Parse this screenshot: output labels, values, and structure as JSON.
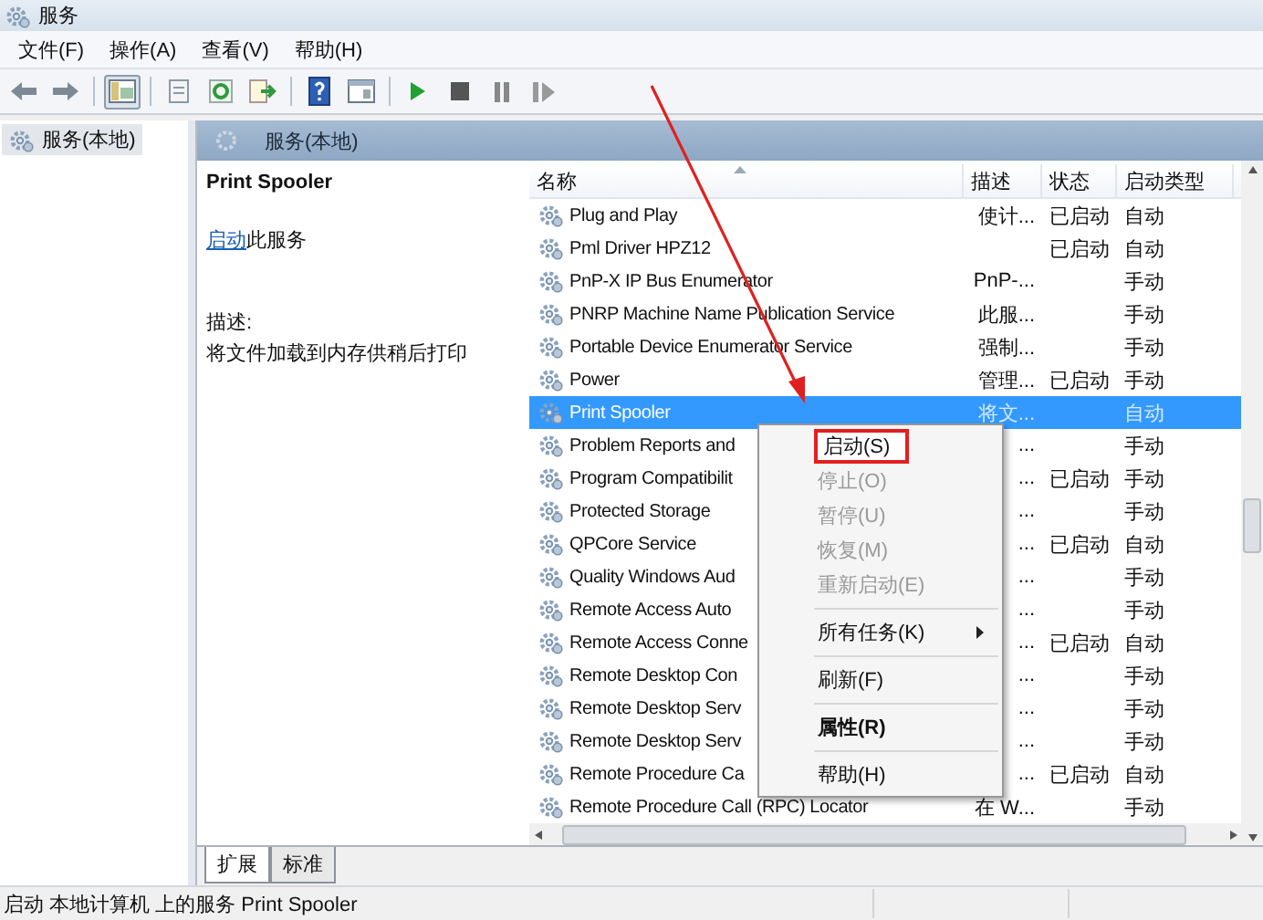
{
  "window": {
    "title": "服务"
  },
  "menu": [
    "文件(F)",
    "操作(A)",
    "查看(V)",
    "帮助(H)"
  ],
  "toolbar": [
    {
      "kind": "back"
    },
    {
      "kind": "forward"
    },
    {
      "kind": "sep"
    },
    {
      "kind": "tree",
      "selected": true
    },
    {
      "kind": "sep"
    },
    {
      "kind": "props"
    },
    {
      "kind": "refresh"
    },
    {
      "kind": "export"
    },
    {
      "kind": "sep"
    },
    {
      "kind": "help"
    },
    {
      "kind": "view"
    },
    {
      "kind": "sep"
    },
    {
      "kind": "play"
    },
    {
      "kind": "stop"
    },
    {
      "kind": "pause"
    },
    {
      "kind": "resume"
    }
  ],
  "tree": [
    {
      "label": "服务(本地)",
      "selected": true
    }
  ],
  "panel_title": "服务(本地)",
  "detail": {
    "service": "Print Spooler",
    "action_link": "启动",
    "action_text": "此服务",
    "description_label": "描述:",
    "description": "将文件加载到内存供稍后打印"
  },
  "table": {
    "columns": [
      "名称",
      "描述",
      "状态",
      "启动类型"
    ],
    "rows": [
      {
        "name": "Plug and Play",
        "desc": "使计...",
        "status": "已启动",
        "startup": "自动",
        "selected": false
      },
      {
        "name": "Pml Driver HPZ12",
        "status": "已启动",
        "startup": "自动",
        "selected": false
      },
      {
        "name": "PnP-X IP Bus Enumerator",
        "desc": "PnP-...",
        "startup": "手动",
        "selected": false
      },
      {
        "name": "PNRP Machine Name Publication Service",
        "desc": "此服...",
        "startup": "手动",
        "selected": false
      },
      {
        "name": "Portable Device Enumerator Service",
        "desc": "强制...",
        "startup": "手动",
        "selected": false
      },
      {
        "name": "Power",
        "desc": "管理...",
        "status": "已启动",
        "startup": "手动",
        "selected": false
      },
      {
        "name": "Print Spooler",
        "desc": "将文...",
        "startup": "自动",
        "selected": true
      },
      {
        "name": "Problem Reports and",
        "desc": "...",
        "startup": "手动",
        "selected": false
      },
      {
        "name": "Program Compatibilit",
        "desc": "...",
        "status": "已启动",
        "startup": "手动",
        "selected": false
      },
      {
        "name": "Protected Storage",
        "desc": "...",
        "startup": "手动",
        "selected": false
      },
      {
        "name": "QPCore Service",
        "desc": "...",
        "status": "已启动",
        "startup": "自动",
        "selected": false
      },
      {
        "name": "Quality Windows Aud",
        "desc": "...",
        "startup": "手动",
        "selected": false
      },
      {
        "name": "Remote Access Auto",
        "desc": "...",
        "startup": "手动",
        "selected": false
      },
      {
        "name": "Remote Access Conne",
        "desc": "...",
        "status": "已启动",
        "startup": "自动",
        "selected": false
      },
      {
        "name": "Remote Desktop Con",
        "desc": "...",
        "startup": "手动",
        "selected": false
      },
      {
        "name": "Remote Desktop Serv",
        "desc": "...",
        "startup": "手动",
        "selected": false
      },
      {
        "name": "Remote Desktop Serv",
        "desc": "...",
        "startup": "手动",
        "selected": false
      },
      {
        "name": "Remote Procedure Ca",
        "desc": "...",
        "status": "已启动",
        "startup": "自动",
        "selected": false
      },
      {
        "name": "Remote Procedure Call (RPC) Locator",
        "desc": "在 W...",
        "startup": "手动",
        "selected": false
      }
    ]
  },
  "context_menu": [
    {
      "kind": "item",
      "label": "启动(S)",
      "disabled": false,
      "marked": true
    },
    {
      "kind": "item",
      "label": "停止(O)",
      "disabled": true,
      "marked": false
    },
    {
      "kind": "item",
      "label": "暂停(U)",
      "disabled": true,
      "marked": false
    },
    {
      "kind": "item",
      "label": "恢复(M)",
      "disabled": true,
      "marked": false
    },
    {
      "kind": "item",
      "label": "重新启动(E)",
      "disabled": true,
      "marked": false
    },
    {
      "kind": "separator"
    },
    {
      "kind": "submenu",
      "label": "所有任务(K)",
      "disabled": false,
      "marked": false
    },
    {
      "kind": "separator"
    },
    {
      "kind": "item",
      "label": "刷新(F)",
      "disabled": false,
      "marked": false
    },
    {
      "kind": "separator"
    },
    {
      "kind": "default",
      "label": "属性(R)",
      "disabled": false,
      "marked": false
    },
    {
      "kind": "separator"
    },
    {
      "kind": "item",
      "label": "帮助(H)",
      "disabled": false,
      "marked": false
    }
  ],
  "view_tabs": [
    {
      "label": "扩展",
      "selected": true
    },
    {
      "label": "标准",
      "selected": false
    }
  ],
  "status_bar": "启动 本地计算机 上的服务 Print Spooler"
}
